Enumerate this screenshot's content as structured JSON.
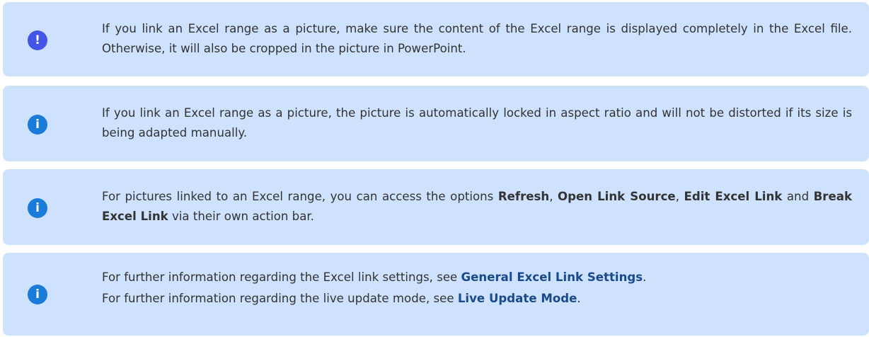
{
  "notes": [
    {
      "type": "warning",
      "icon": "!",
      "text": "If you link an Excel range as a picture, make sure the content of the Excel range is displayed completely in the Excel file. Otherwise, it will also be cropped in the picture in PowerPoint."
    },
    {
      "type": "info",
      "icon": "i",
      "text": "If you link an Excel range as a picture, the picture is automatically locked in aspect ratio and will not be distorted if its size is being adapted manually."
    },
    {
      "type": "info",
      "icon": "i",
      "parts": {
        "t1": "For pictures linked to an Excel range, you can access the options ",
        "b1": "Refresh",
        "t2": ", ",
        "b2": "Open Link Source",
        "t3": ", ",
        "b3": "Edit Excel Link",
        "t4": " and ",
        "b4": "Break Excel Link",
        "t5": " via their own action bar."
      }
    },
    {
      "type": "info",
      "icon": "i",
      "lines": [
        {
          "prefix": "For further information regarding the Excel link settings, see ",
          "link": "General Excel Link Settings",
          "suffix": "."
        },
        {
          "prefix": "For further information regarding the live update mode, see ",
          "link": "Live Update Mode",
          "suffix": "."
        }
      ]
    }
  ],
  "colors": {
    "box_background": "#cfe2fd",
    "info_icon": "#1a7bd8",
    "warning_icon": "#4456e6",
    "text": "#333333",
    "link": "#1a4a8c"
  }
}
